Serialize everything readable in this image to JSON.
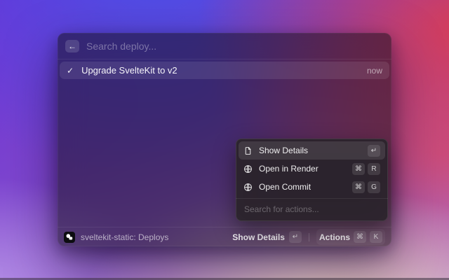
{
  "palette": {
    "back_icon": "←",
    "search_placeholder": "Search deploy..."
  },
  "results": [
    {
      "check_icon": "✓",
      "label": "Upgrade SvelteKit to v2",
      "time": "now"
    }
  ],
  "actions_menu": {
    "items": [
      {
        "icon": "document-icon",
        "label": "Show Details",
        "keys": [
          "↵"
        ]
      },
      {
        "icon": "globe-icon",
        "label": "Open in Render",
        "keys": [
          "⌘",
          "R"
        ]
      },
      {
        "icon": "globe-icon",
        "label": "Open Commit",
        "keys": [
          "⌘",
          "G"
        ]
      }
    ],
    "search_placeholder": "Search for actions..."
  },
  "footer": {
    "context": "sveltekit-static: Deploys",
    "primary_label": "Show Details",
    "primary_key": "↵",
    "actions_label": "Actions",
    "actions_keys": [
      "⌘",
      "K"
    ]
  },
  "colors": {
    "accent_blue": "#4a50e8",
    "accent_purple": "#6c32d4",
    "accent_red": "#d83c54",
    "accent_pink": "#d0507d",
    "accent_cream": "#f8e0ba",
    "accent_lavender": "#ba98eb",
    "selection_highlight": "rgba(255,255,255,0.10)"
  }
}
